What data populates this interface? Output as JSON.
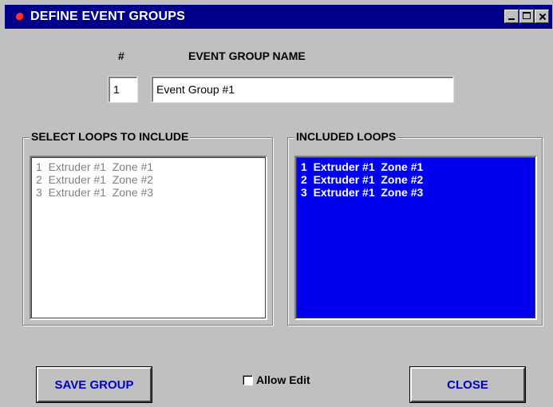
{
  "window": {
    "title": "DEFINE EVENT GROUPS",
    "controls": [
      "minimize-icon",
      "maximize-icon",
      "close-icon"
    ],
    "title_bar_color": "#00008b"
  },
  "form": {
    "number_label": "#",
    "name_label": "EVENT GROUP NAME",
    "number_value": "1",
    "name_value": "Event Group #1"
  },
  "select_loops": {
    "legend": "SELECT LOOPS TO INCLUDE",
    "items": [
      "1  Extruder #1  Zone #1",
      "2  Extruder #1  Zone #2",
      "3  Extruder #1  Zone #3"
    ]
  },
  "included_loops": {
    "legend": "INCLUDED LOOPS",
    "items": [
      "1  Extruder #1  Zone #1",
      "2  Extruder #1  Zone #2",
      "3  Extruder #1  Zone #3"
    ],
    "background_color": "#0000ee"
  },
  "buttons": {
    "save_label": "SAVE GROUP",
    "close_label": "CLOSE"
  },
  "allow_edit": {
    "label": "Allow Edit",
    "checked": false
  }
}
